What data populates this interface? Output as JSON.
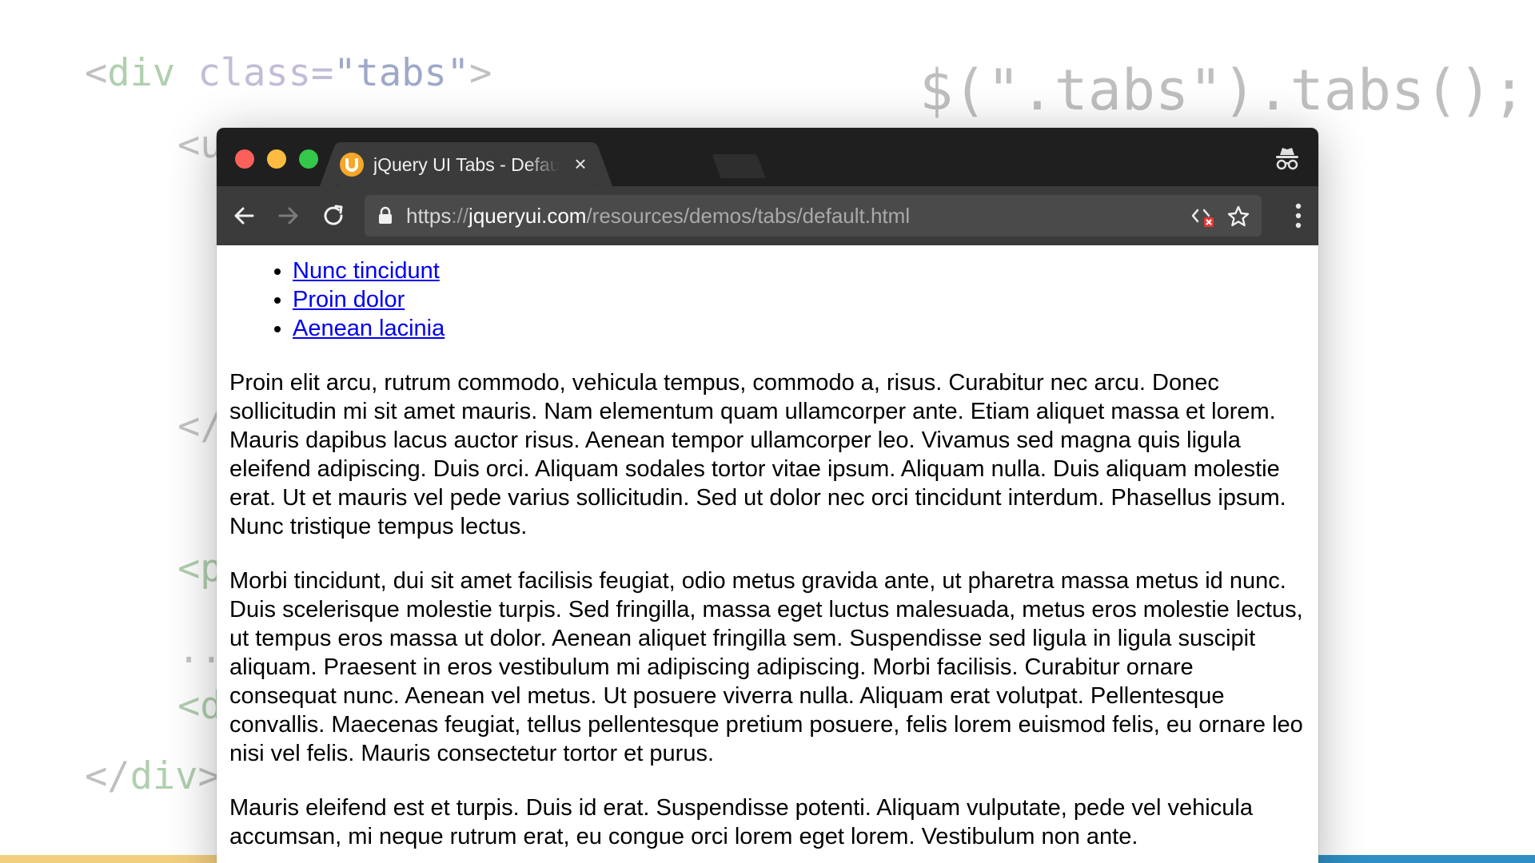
{
  "background_code": {
    "line1": {
      "open": "<",
      "tag": "div",
      "attr": " class=",
      "value": "\"tabs\"",
      "close": ">"
    },
    "js": "$(\".tabs\").tabs();",
    "line2": "<u",
    "line3": "</",
    "line4": "<p",
    "line5": "...",
    "line6": "<d",
    "line7": {
      "open": "</",
      "tag": "div",
      "close": ">"
    }
  },
  "browser": {
    "tab": {
      "title": "jQuery UI Tabs - Default functionality",
      "close": "×"
    },
    "url": {
      "scheme": "https",
      "sep": "://",
      "host": "jqueryui.com",
      "path": "/resources/demos/tabs/default.html"
    }
  },
  "page": {
    "tabs": [
      {
        "label": "Nunc tincidunt"
      },
      {
        "label": "Proin dolor"
      },
      {
        "label": "Aenean lacinia"
      }
    ],
    "paragraphs": [
      "Proin elit arcu, rutrum commodo, vehicula tempus, commodo a, risus. Curabitur nec arcu. Donec sollicitudin mi sit amet mauris. Nam elementum quam ullamcorper ante. Etiam aliquet massa et lorem. Mauris dapibus lacus auctor risus. Aenean tempor ullamcorper leo. Vivamus sed magna quis ligula eleifend adipiscing. Duis orci. Aliquam sodales tortor vitae ipsum. Aliquam nulla. Duis aliquam molestie erat. Ut et mauris vel pede varius sollicitudin. Sed ut dolor nec orci tincidunt interdum. Phasellus ipsum. Nunc tristique tempus lectus.",
      "Morbi tincidunt, dui sit amet facilisis feugiat, odio metus gravida ante, ut pharetra massa metus id nunc. Duis scelerisque molestie turpis. Sed fringilla, massa eget luctus malesuada, metus eros molestie lectus, ut tempus eros massa ut dolor. Aenean aliquet fringilla sem. Suspendisse sed ligula in ligula suscipit aliquam. Praesent in eros vestibulum mi adipiscing adipiscing. Morbi facilisis. Curabitur ornare consequat nunc. Aenean vel metus. Ut posuere viverra nulla. Aliquam erat volutpat. Pellentesque convallis. Maecenas feugiat, tellus pellentesque pretium posuere, felis lorem euismod felis, eu ornare leo nisi vel felis. Mauris consectetur tortor et purus.",
      "Mauris eleifend est et turpis. Duis id erat. Suspendisse potenti. Aliquam vulputate, pede vel vehicula accumsan, mi neque rutrum erat, eu congue orci lorem eget lorem. Vestibulum non ante."
    ]
  },
  "colors": {
    "titlebar": "#1f1f1f",
    "toolbar": "#3b3b3b",
    "link": "#0000ee",
    "favicon": "#f6a828"
  }
}
